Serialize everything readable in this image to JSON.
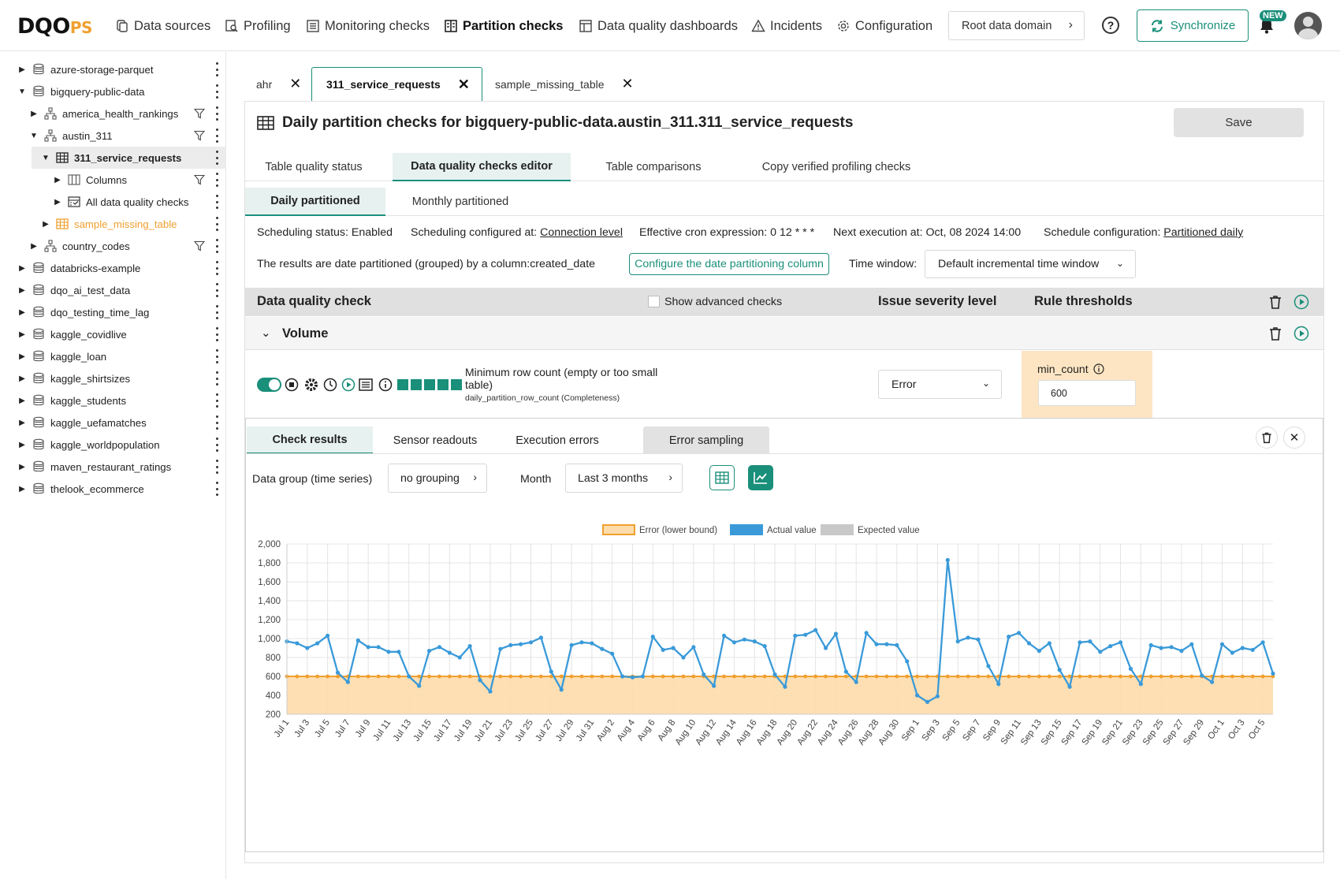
{
  "logo": {
    "main": "DQO",
    "suffix": "PS"
  },
  "nav": [
    {
      "label": "Data sources",
      "icon": "data-sources-icon"
    },
    {
      "label": "Profiling",
      "icon": "profiling-icon"
    },
    {
      "label": "Monitoring checks",
      "icon": "monitoring-checks-icon"
    },
    {
      "label": "Partition checks",
      "icon": "partition-checks-icon",
      "active": true
    },
    {
      "label": "Data quality dashboards",
      "icon": "dashboard-icon"
    },
    {
      "label": "Incidents",
      "icon": "warning-icon"
    },
    {
      "label": "Configuration",
      "icon": "gear-icon"
    }
  ],
  "root_domain": "Root data domain",
  "help_icon": "?",
  "synchronize": "Synchronize",
  "new_badge": "NEW",
  "tree": [
    {
      "label": "azure-storage-parquet",
      "icon": "database-icon",
      "level": 0,
      "expanded": false
    },
    {
      "label": "bigquery-public-data",
      "icon": "database-icon",
      "level": 0,
      "expanded": true
    },
    {
      "label": "america_health_rankings",
      "icon": "schema-icon",
      "level": 1,
      "expanded": false,
      "filter": true
    },
    {
      "label": "austin_311",
      "icon": "schema-icon",
      "level": 1,
      "expanded": true,
      "filter": true
    },
    {
      "label": "311_service_requests",
      "icon": "table-icon",
      "level": 2,
      "expanded": true,
      "selected": true
    },
    {
      "label": "Columns",
      "icon": "columns-icon",
      "level": 3,
      "expanded": false,
      "filter": true
    },
    {
      "label": "All data quality checks",
      "icon": "checks-icon",
      "level": 3,
      "expanded": false
    },
    {
      "label": "sample_missing_table",
      "icon": "table-icon",
      "level": 2,
      "expanded": false,
      "orange": true
    },
    {
      "label": "country_codes",
      "icon": "schema-icon",
      "level": 1,
      "expanded": false,
      "filter": true
    },
    {
      "label": "databricks-example",
      "icon": "database-icon",
      "level": 0,
      "expanded": false
    },
    {
      "label": "dqo_ai_test_data",
      "icon": "database-icon",
      "level": 0,
      "expanded": false
    },
    {
      "label": "dqo_testing_time_lag",
      "icon": "database-icon",
      "level": 0,
      "expanded": false
    },
    {
      "label": "kaggle_covidlive",
      "icon": "database-icon",
      "level": 0,
      "expanded": false
    },
    {
      "label": "kaggle_loan",
      "icon": "database-icon",
      "level": 0,
      "expanded": false
    },
    {
      "label": "kaggle_shirtsizes",
      "icon": "database-icon",
      "level": 0,
      "expanded": false
    },
    {
      "label": "kaggle_students",
      "icon": "database-icon",
      "level": 0,
      "expanded": false
    },
    {
      "label": "kaggle_uefamatches",
      "icon": "database-icon",
      "level": 0,
      "expanded": false
    },
    {
      "label": "kaggle_worldpopulation",
      "icon": "database-icon",
      "level": 0,
      "expanded": false
    },
    {
      "label": "maven_restaurant_ratings",
      "icon": "database-icon",
      "level": 0,
      "expanded": false
    },
    {
      "label": "thelook_ecommerce",
      "icon": "database-icon",
      "level": 0,
      "expanded": false
    }
  ],
  "file_tabs": [
    {
      "label": "ahr"
    },
    {
      "label": "311_service_requests",
      "active": true
    },
    {
      "label": "sample_missing_table"
    }
  ],
  "page_title": "Daily partition checks for bigquery-public-data.austin_311.311_service_requests",
  "save_label": "Save",
  "subtabs": [
    "Table quality status",
    "Data quality checks editor",
    "Table comparisons",
    "Copy verified profiling checks"
  ],
  "subtabs_active": 1,
  "partition_tabs": [
    "Daily partitioned",
    "Monthly partitioned"
  ],
  "schedule": {
    "status_label": "Scheduling status:",
    "status_value": "Enabled",
    "configured_label": "Scheduling configured at:",
    "configured_value": "Connection level",
    "cron_label": "Effective cron expression:",
    "cron_value": "0 12 * * *",
    "next_label": "Next execution at:",
    "next_value": "Oct, 08 2024 14:00",
    "config_label": "Schedule configuration:",
    "config_value": "Partitioned daily"
  },
  "partition_info": "The results are date partitioned (grouped) by a column:created_date",
  "configure_partition_button": "Configure the date partitioning column",
  "time_window_label": "Time window:",
  "time_window_value": "Default incremental time window",
  "check_header": {
    "dq_check": "Data quality check",
    "show_advanced": "Show advanced checks",
    "severity": "Issue severity level",
    "thresholds": "Rule thresholds"
  },
  "category": "Volume",
  "check": {
    "name": "Minimum row count (empty or too small table)",
    "id": "daily_partition_row_count (Completeness)",
    "severity": "Error",
    "param_label": "min_count",
    "param_value": "600"
  },
  "results_tabs": [
    "Check results",
    "Sensor readouts",
    "Execution errors",
    "Error sampling"
  ],
  "data_group_label": "Data group (time series)",
  "data_group_value": "no grouping",
  "month_label": "Month",
  "month_value": "Last 3 months",
  "colors": {
    "accent": "#1a8f7a",
    "actual": "#3a9ad9",
    "error": "#f0a030",
    "error_fill": "#fddcab",
    "expected": "#c8c8c8"
  },
  "chart_data": {
    "type": "line",
    "legend": [
      "Error (lower bound)",
      "Actual value",
      "Expected value"
    ],
    "legend_position": "top",
    "ylim": [
      200,
      2000
    ],
    "yticks": [
      200,
      400,
      600,
      800,
      1000,
      1200,
      1400,
      1600,
      1800,
      2000
    ],
    "ytick_labels": [
      "200",
      "400",
      "600",
      "800",
      "1,000",
      "1,200",
      "1,400",
      "1,600",
      "1,800",
      "2,000"
    ],
    "grid": true,
    "x_labels": [
      "Jul 1",
      "Jul 3",
      "Jul 5",
      "Jul 7",
      "Jul 9",
      "Jul 11",
      "Jul 13",
      "Jul 15",
      "Jul 17",
      "Jul 19",
      "Jul 21",
      "Jul 23",
      "Jul 25",
      "Jul 27",
      "Jul 29",
      "Jul 31",
      "Aug 2",
      "Aug 4",
      "Aug 6",
      "Aug 8",
      "Aug 10",
      "Aug 12",
      "Aug 14",
      "Aug 16",
      "Aug 18",
      "Aug 20",
      "Aug 22",
      "Aug 24",
      "Aug 26",
      "Aug 28",
      "Aug 30",
      "Sep 1",
      "Sep 3",
      "Sep 5",
      "Sep 7",
      "Sep 9",
      "Sep 11",
      "Sep 13",
      "Sep 15",
      "Sep 17",
      "Sep 19",
      "Sep 21",
      "Sep 23",
      "Sep 25",
      "Sep 27",
      "Sep 29",
      "Oct 1",
      "Oct 3",
      "Oct 5"
    ],
    "series": [
      {
        "name": "Actual value",
        "values": [
          970,
          950,
          900,
          950,
          1030,
          640,
          540,
          980,
          910,
          910,
          860,
          860,
          600,
          500,
          870,
          910,
          850,
          800,
          920,
          560,
          440,
          890,
          930,
          940,
          960,
          1010,
          650,
          460,
          930,
          960,
          950,
          890,
          840,
          600,
          590,
          600,
          1020,
          880,
          900,
          800,
          910,
          620,
          500,
          1030,
          960,
          990,
          970,
          920,
          620,
          490,
          1030,
          1040,
          1090,
          900,
          1050,
          650,
          540,
          1060,
          940,
          940,
          930,
          760,
          400,
          330,
          390,
          1830,
          970,
          1010,
          990,
          710,
          520,
          1020,
          1060,
          950,
          870,
          950,
          670,
          490,
          960,
          970,
          860,
          920,
          960,
          680,
          520,
          930,
          900,
          910,
          870,
          940,
          610,
          540,
          940,
          850,
          900,
          880,
          960,
          630
        ]
      },
      {
        "name": "Error (lower bound)",
        "values": [
          600,
          600,
          600,
          600,
          600,
          600,
          600,
          600,
          600,
          600,
          600,
          600,
          600,
          600,
          600,
          600,
          600,
          600,
          600,
          600,
          600,
          600,
          600,
          600,
          600,
          600,
          600,
          600,
          600,
          600,
          600,
          600,
          600,
          600,
          600,
          600,
          600,
          600,
          600,
          600,
          600,
          600,
          600,
          600,
          600,
          600,
          600,
          600,
          600,
          600,
          600,
          600,
          600,
          600,
          600,
          600,
          600,
          600,
          600,
          600,
          600,
          600,
          600,
          600,
          600,
          600,
          600,
          600,
          600,
          600,
          600,
          600,
          600,
          600,
          600,
          600,
          600,
          600,
          600,
          600,
          600,
          600,
          600,
          600,
          600,
          600,
          600,
          600,
          600,
          600,
          600,
          600,
          600,
          600,
          600,
          600,
          600,
          600
        ]
      }
    ]
  }
}
